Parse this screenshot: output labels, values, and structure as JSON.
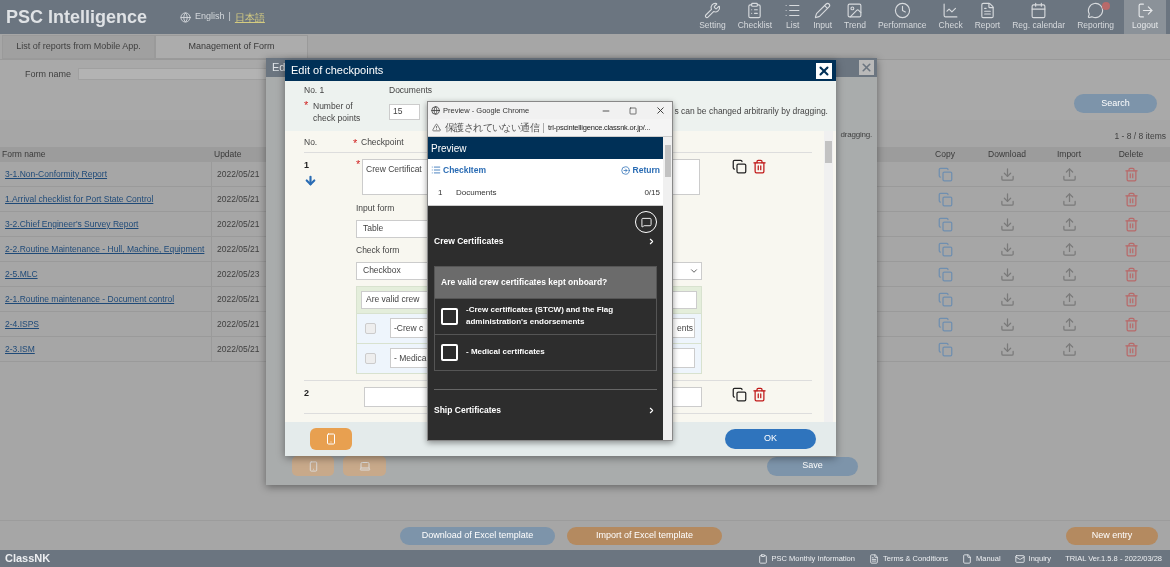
{
  "header": {
    "title": "PSC Intelligence",
    "language": {
      "english": "English",
      "separator": "|",
      "japanese": "日本語"
    },
    "nav": [
      {
        "label": "Setting",
        "kind": "item",
        "badge": false
      },
      {
        "label": "Checklist",
        "kind": "item",
        "badge": false
      },
      {
        "label": "List",
        "kind": "item",
        "badge": false
      },
      {
        "label": "Input",
        "kind": "item",
        "badge": false
      },
      {
        "label": "Trend",
        "kind": "item",
        "badge": false
      },
      {
        "label": "Performance",
        "kind": "item",
        "badge": false
      },
      {
        "label": "Check",
        "kind": "item",
        "badge": false
      },
      {
        "label": "Report",
        "kind": "item",
        "badge": false
      },
      {
        "label": "Reg. calendar",
        "kind": "item",
        "badge": false
      },
      {
        "label": "Reporting",
        "kind": "item",
        "badge": true
      },
      {
        "label": "Logout",
        "kind": "logout",
        "badge": false
      }
    ]
  },
  "tabs": [
    {
      "label": "List of reports from Mobile App.",
      "selected": false
    },
    {
      "label": "Management of Form",
      "selected": true
    }
  ],
  "search": {
    "label": "Form name",
    "button": "Search"
  },
  "count": "1 - 8 / 8 items",
  "table": {
    "columns": [
      "Form name",
      "Update",
      "Copy",
      "Download",
      "Import",
      "Delete"
    ],
    "rows": [
      {
        "name": "3-1.Non-Conformity Report",
        "update": "2022/05/21"
      },
      {
        "name": "1.Arrival checklist for Port State Control",
        "update": "2022/05/21"
      },
      {
        "name": "3-2.Chief Engineer's Survey Report",
        "update": "2022/05/21"
      },
      {
        "name": "2-2.Routine Maintenance - Hull, Machine, Equipment",
        "update": "2022/05/21"
      },
      {
        "name": "2-5.MLC",
        "update": "2022/05/23"
      },
      {
        "name": "2-1.Routine maintenance - Document control",
        "update": "2022/05/21"
      },
      {
        "name": "2-4.ISPS",
        "update": "2022/05/21"
      },
      {
        "name": "2-3.ISM",
        "update": "2022/05/21"
      }
    ]
  },
  "actions": [
    "Download of Excel template",
    "Import of Excel template",
    "New entry"
  ],
  "footer": {
    "brand": "ClassNK",
    "links": [
      "PSC Monthly Information",
      "Terms & Conditions",
      "Manual",
      "Inquiry"
    ],
    "version": "TRIAL Ver.1.5.8 - 2022/03/28"
  },
  "back_dialog": {
    "title": "Ed",
    "note": "dragging.",
    "save": "Save"
  },
  "dialog": {
    "title": "Edit of checkpoints",
    "count_required": "*",
    "checkpoint_required": "*",
    "no": "No. 1",
    "category": "Documents",
    "count_label": "Number of check points",
    "count_value": "15",
    "note": "s can be changed arbitrarily by dragging.",
    "columns": [
      "No.",
      "Checkpoint"
    ],
    "checkpoints": [
      {
        "no": "1",
        "required": "*",
        "text": "Crew Certificat",
        "input_label": "Input form",
        "input_value": "Table",
        "check_label": "Check form",
        "check_value": "Checkbox",
        "question": "Are valid crew",
        "items": [
          {
            "text": "-Crew c",
            "tail": "ents",
            "checked": false
          },
          {
            "text": "- Medica",
            "checked": false
          }
        ]
      },
      {
        "no": "2"
      }
    ],
    "ok": "OK"
  },
  "preview": {
    "window_title": "Preview - Google Chrome",
    "security": "保護されていない通信",
    "url": "trl-pscintelligence.classnk.or.jp/...",
    "title": "Preview",
    "checkitem": "CheckItem",
    "return": "Return",
    "row": {
      "no": "1",
      "name": "Documents",
      "count": "0/15"
    },
    "sections": [
      {
        "title": "Crew Certificates",
        "question": "Are valid crew certificates kept onboard?",
        "items": [
          {
            "text": "-Crew certificates (STCW) and the Flag administration's endorsements",
            "checked": false
          },
          {
            "text": "- Medical certificates",
            "checked": false
          }
        ]
      },
      {
        "title": "Ship Certificates"
      }
    ]
  }
}
